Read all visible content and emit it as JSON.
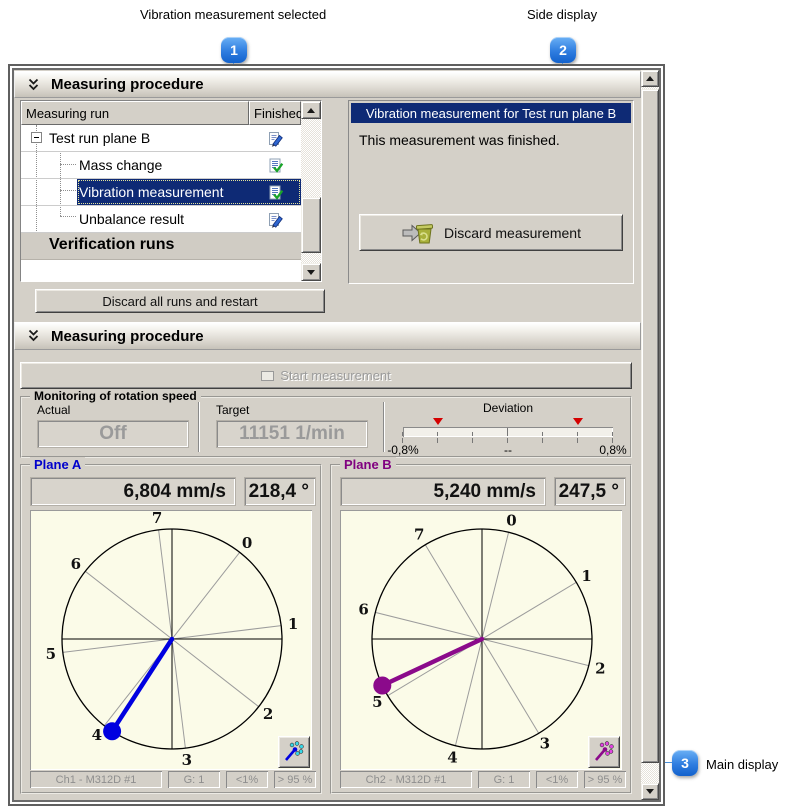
{
  "annotations": {
    "callouts": [
      {
        "number": "1",
        "label": "Vibration measurement selected"
      },
      {
        "number": "2",
        "label": "Side display"
      },
      {
        "number": "3",
        "label": "Main display"
      }
    ]
  },
  "colors": {
    "selection_navy": "#0e2a75",
    "callout_blue": "#2f7de0",
    "window_bg": "#d4d0c8",
    "chart_bg": "#fbfbe8",
    "marker_red": "#d40000",
    "plane_a_accent": "#0000e0",
    "plane_b_accent": "#8b0a8b"
  },
  "panel1": {
    "header": "Measuring procedure",
    "tree": {
      "columns": [
        "Measuring run",
        "Finished"
      ],
      "items": [
        {
          "label": "Test run plane B",
          "level": 1,
          "icon": "edit",
          "expander": true,
          "selected": false,
          "section": false
        },
        {
          "label": "Mass change",
          "level": 2,
          "icon": "check",
          "expander": false,
          "selected": false,
          "section": false
        },
        {
          "label": "Vibration measurement",
          "level": 2,
          "icon": "check",
          "expander": false,
          "selected": true,
          "section": false
        },
        {
          "label": "Unbalance result",
          "level": 2,
          "icon": "edit",
          "expander": false,
          "selected": false,
          "section": false
        },
        {
          "label": "Verification runs",
          "level": 0,
          "icon": "",
          "expander": false,
          "selected": false,
          "section": true
        }
      ]
    },
    "discard_all_button": "Discard all runs and restart",
    "side_panel": {
      "title": "Vibration measurement for Test run plane B",
      "message": "This measurement was finished.",
      "discard_button": "Discard measurement"
    }
  },
  "panel2": {
    "header": "Measuring procedure",
    "start_button": "Start measurement",
    "monitoring": {
      "title": "Monitoring of rotation speed",
      "actual_label": "Actual",
      "actual_value": "Off",
      "target_label": "Target",
      "target_value": "11151 1/min",
      "deviation_label": "Deviation",
      "scale_left": "-0,8%",
      "scale_center": "--",
      "scale_right": "0,8%",
      "tick_count": 7,
      "marker_fractions": [
        0.167,
        0.833
      ]
    }
  },
  "chart_data": [
    {
      "type": "polar",
      "name": "Plane A",
      "amplitude": "6,804 mm/s",
      "phase": "218,4 °",
      "dial_labels": [
        "0",
        "1",
        "2",
        "3",
        "4",
        "5",
        "6",
        "7"
      ],
      "dial_base_angle_deg": 52,
      "dial_step_deg": -45,
      "vector_drawn_angle_deg": 237,
      "vector_length_frac": 1.0,
      "vector_color": "#0000e0",
      "label_color": "#0000cc",
      "dot_color": "#38d8e8",
      "status": [
        "Ch1 - M312D #1",
        "G: 1",
        "<1%",
        "> 95 %"
      ]
    },
    {
      "type": "polar",
      "name": "Plane B",
      "amplitude": "5,240 mm/s",
      "phase": "247,5 °",
      "dial_labels": [
        "0",
        "1",
        "2",
        "3",
        "4",
        "5",
        "6",
        "7"
      ],
      "dial_base_angle_deg": 76,
      "dial_step_deg": -45,
      "vector_drawn_angle_deg": 205,
      "vector_length_frac": 1.0,
      "vector_color": "#8b0a8b",
      "label_color": "#800080",
      "dot_color": "#e344e3",
      "status": [
        "Ch2 - M312D #1",
        "G: 1",
        "<1%",
        "> 95 %"
      ]
    }
  ]
}
